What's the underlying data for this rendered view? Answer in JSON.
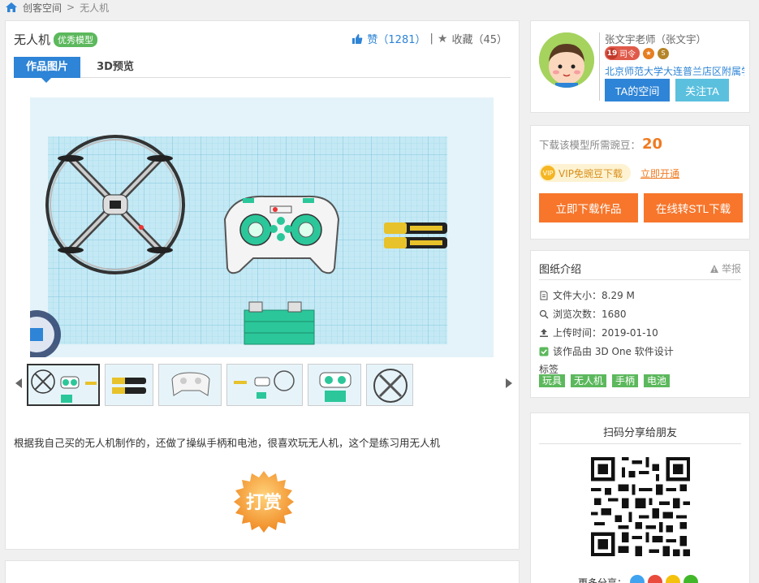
{
  "breadcrumb": {
    "home": "创客空间",
    "sep": ">",
    "current": "无人机"
  },
  "model": {
    "title": "无人机",
    "badge": "优秀模型",
    "like_label": "赞（1281）",
    "divider": "|",
    "favorite_label": "收藏（45）"
  },
  "tabs": {
    "images": "作品图片",
    "preview3d": "3D预览"
  },
  "description": "根据我自己买的无人机制作的，还做了操纵手柄和电池，很喜欢玩无人机，这个是练习用无人机",
  "reward": {
    "label": "打赏"
  },
  "author": {
    "name": "张文宇老师（张文宇）",
    "level_num": "19",
    "level_title": "司令",
    "school": "北京师范大学大连普兰店区附属学校",
    "space_button": "TA的空间",
    "follow_button": "关注TA"
  },
  "download": {
    "need_label": "下载该模型所需豌豆：",
    "need_value": "20",
    "vip_text": "VIP免豌豆下载",
    "vip_badge": "VIP",
    "vip_link": "立即开通",
    "download_button": "立即下载作品",
    "stl_button": "在线转STL下载"
  },
  "info": {
    "title": "图纸介绍",
    "report": "举报",
    "file_size": "文件大小：8.29 M",
    "views": "浏览次数：1680",
    "upload_time": "上传时间：2019-01-10",
    "software": "该作品由 3D One 软件设计",
    "tags_label": "标签",
    "tags": [
      "玩具",
      "无人机",
      "手柄",
      "电池"
    ]
  },
  "share": {
    "title": "扫码分享给朋友",
    "more": "更多分享："
  },
  "colors": {
    "primary": "#2e84d6",
    "accent": "#f7762b",
    "green": "#5cb85c",
    "cyan": "#5bc0de"
  }
}
